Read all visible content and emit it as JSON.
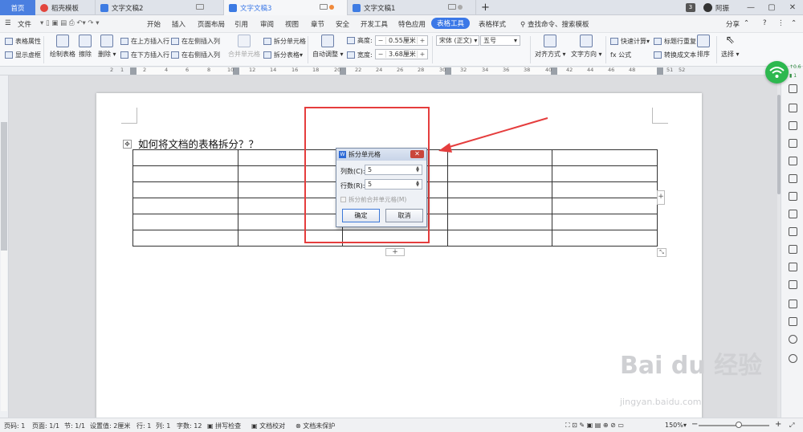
{
  "tabs": {
    "home": "首页",
    "t1": "稻壳模板",
    "t2": "文字文稿2",
    "t3": "文字文稿3",
    "t4": "文字文稿1",
    "badge": "3",
    "user": "阿振"
  },
  "menu": {
    "file": "文件",
    "items": [
      "开始",
      "插入",
      "页面布局",
      "引用",
      "审阅",
      "视图",
      "章节",
      "安全",
      "开发工具",
      "特色应用",
      "表格工具",
      "表格样式"
    ],
    "search": "查找命令、搜索模板",
    "share": "分享",
    "help": "?"
  },
  "toolbar": {
    "table_props": "表格属性",
    "show_grid": "显示虚框",
    "draw_table": "绘制表格",
    "erase": "擦除",
    "delete": "删除",
    "insert_above": "在上方插入行",
    "insert_below": "在下方插入行",
    "insert_left": "在左侧插入列",
    "insert_right": "在右侧插入列",
    "merge_cells": "合并单元格",
    "split_cells": "拆分单元格",
    "split_table": "拆分表格",
    "auto_fit": "自动调整",
    "height_label": "高度:",
    "height_value": "0.55厘米",
    "width_label": "宽度:",
    "width_value": "3.68厘米",
    "font_name": "宋体 (正文)",
    "font_size": "五号",
    "align": "对齐方式",
    "text_dir": "文字方向",
    "quick_calc": "快速计算",
    "formula": "fx 公式",
    "repeat_header": "标题行重复",
    "to_text": "转换成文本",
    "sort": "排序",
    "select": "选择"
  },
  "ruler": {
    "h_numbers": [
      "2",
      "1",
      "2",
      "4",
      "6",
      "8",
      "10",
      "12",
      "14",
      "16",
      "18",
      "20",
      "22",
      "24",
      "26",
      "28",
      "30",
      "32",
      "34",
      "36",
      "38",
      "40",
      "42",
      "44",
      "46",
      "48",
      "51",
      "52"
    ]
  },
  "document": {
    "title": "如何将文档的表格拆分？？",
    "table_rows": 6,
    "table_cols": 5
  },
  "dialog": {
    "title": "拆分单元格",
    "cols_label": "列数(C):",
    "cols_value": "5",
    "rows_label": "行数(R):",
    "rows_value": "5",
    "merge_before": "拆分前合并单元格(M)",
    "ok": "确定",
    "cancel": "取消"
  },
  "sidebar": {
    "net_speed_up": "0.6",
    "net_speed_down": "1"
  },
  "status": {
    "page_no": "页码: 1",
    "pages": "页面: 1/1",
    "section": "节: 1/1",
    "setting": "设置值: 2厘米",
    "row": "行: 1",
    "col": "列: 1",
    "words": "字数: 12",
    "spell": "拼写检查",
    "proof": "文档校对",
    "protect": "文档未保护",
    "zoom": "150%"
  },
  "watermark": {
    "main": "Bai du 经验",
    "sub": "jingyan.baidu.com"
  },
  "colors": {
    "accent": "#3b78e7",
    "highlight_red": "#e53d3d",
    "wifi_green": "#2db84f"
  }
}
